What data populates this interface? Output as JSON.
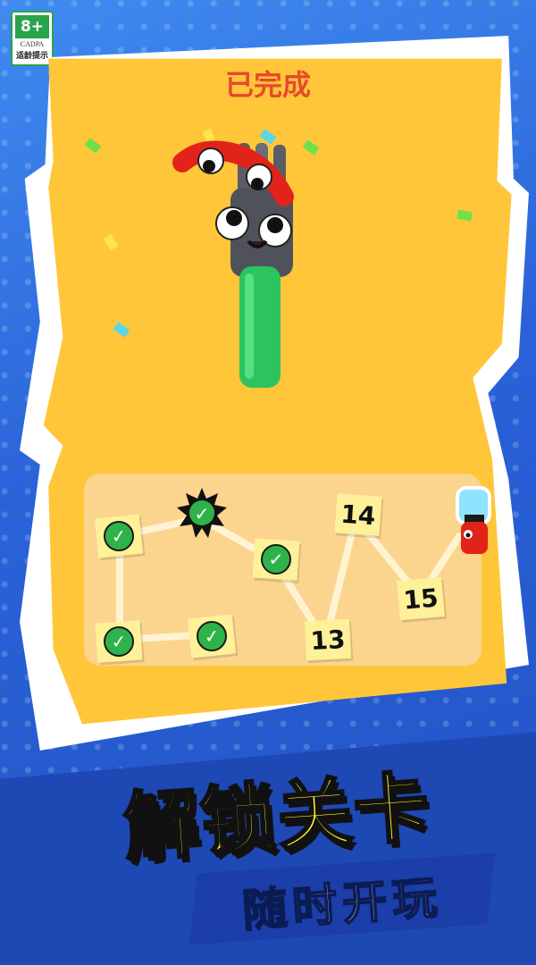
{
  "age_rating": {
    "age": "8+",
    "org": "CADPA",
    "tip": "适龄提示"
  },
  "status_text": "已完成",
  "level_map": {
    "nodes": [
      {
        "id": "node-a",
        "completed": true,
        "label": ""
      },
      {
        "id": "node-b",
        "completed": true,
        "label": "",
        "current": true
      },
      {
        "id": "node-c",
        "completed": true,
        "label": ""
      },
      {
        "id": "node-d",
        "completed": true,
        "label": ""
      },
      {
        "id": "node-e",
        "completed": true,
        "label": ""
      },
      {
        "id": "node-13",
        "completed": false,
        "label": "13"
      },
      {
        "id": "node-14",
        "completed": false,
        "label": "14"
      },
      {
        "id": "node-15",
        "completed": false,
        "label": "15"
      }
    ]
  },
  "headline": "解锁关卡",
  "subheadline": "随时开玩",
  "colors": {
    "paper": "#ffc63a",
    "check": "#2eb34a",
    "headline": "#fff33b",
    "status": "#e8492c"
  },
  "icons": {
    "check": "check-icon",
    "character": "fork-character",
    "player": "player-marker-icon"
  }
}
